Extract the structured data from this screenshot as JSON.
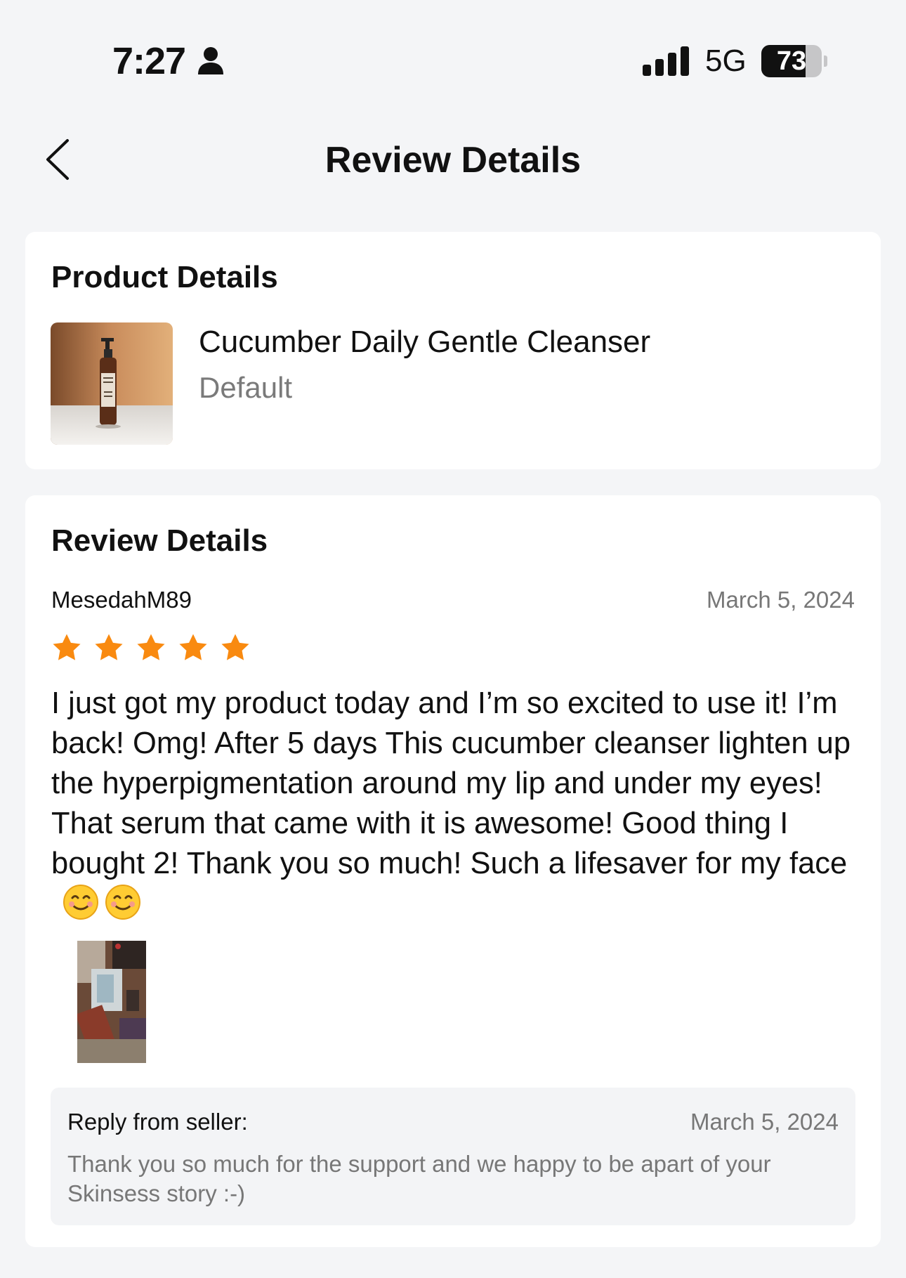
{
  "status_bar": {
    "time": "7:27",
    "network": "5G",
    "battery_level": "73",
    "battery_fraction": 0.73,
    "icons": [
      "person-icon",
      "signal-icon",
      "battery-icon"
    ]
  },
  "header": {
    "title": "Review Details",
    "back_icon": "chevron-left-icon"
  },
  "product": {
    "section_title": "Product Details",
    "name": "Cucumber Daily Gentle Cleanser",
    "variant": "Default"
  },
  "review": {
    "section_title": "Review Details",
    "reviewer": "MesedahM89",
    "date": "March 5, 2024",
    "rating": 5,
    "rating_max": 5,
    "star_color": "#F98A10",
    "text": "I just got my product today and I’m so excited to use it! I’m back! Omg! After 5 days This cucumber cleanser lighten up the hyperpigmentation around my lip and under my eyes! That serum that came with it is awesome! Good thing I bought 2! Thank you so much! Such a lifesaver for my face",
    "emojis": [
      "smiling-face-emoji",
      "smiling-face-emoji"
    ]
  },
  "seller_reply": {
    "label": "Reply from seller:",
    "date": "March 5, 2024",
    "text": "Thank you so much for the support and we happy to be apart of your Skinsess story :-)"
  }
}
